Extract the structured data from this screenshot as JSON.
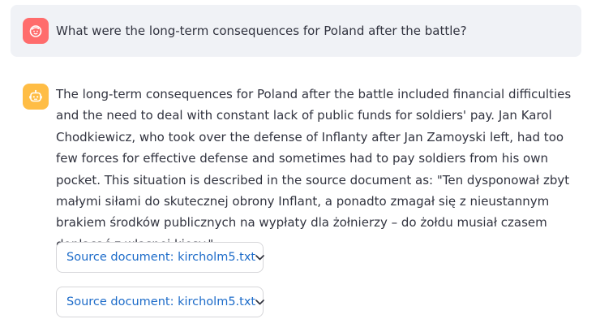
{
  "chat": {
    "user_message": {
      "avatar_icon": "smiley-face-icon",
      "avatar_color": "#ff6c6c",
      "text": "What were the long-term consequences for Poland after the battle?"
    },
    "assistant_message": {
      "avatar_icon": "robot-icon",
      "avatar_color": "#ffbd45",
      "text": "The long-term consequences for Poland after the battle included financial difficulties and the need to deal with constant lack of public funds for soldiers' pay. Jan Karol Chodkiewicz, who took over the defense of Inflanty after Jan Zamoyski left, had too few forces for effective defense and sometimes had to pay soldiers from his own pocket. This situation is described in the source document as: \"Ten dysponował zbyt małymi siłami do skutecznej obrony Inflant, a ponadto zmagał się z nieustannym brakiem środków publicznych na wypłaty dla żołnierzy – do żołdu musiał czasem dopłacać z własnej kiesy.\""
    },
    "sources": [
      {
        "label": "Source document: kircholm5.txt",
        "icon": "chevron-down-icon"
      },
      {
        "label": "Source document: kircholm5.txt",
        "icon": "chevron-down-icon"
      }
    ]
  },
  "colors": {
    "link": "#1c6bc9",
    "user_bubble_bg": "#f0f2f6"
  }
}
